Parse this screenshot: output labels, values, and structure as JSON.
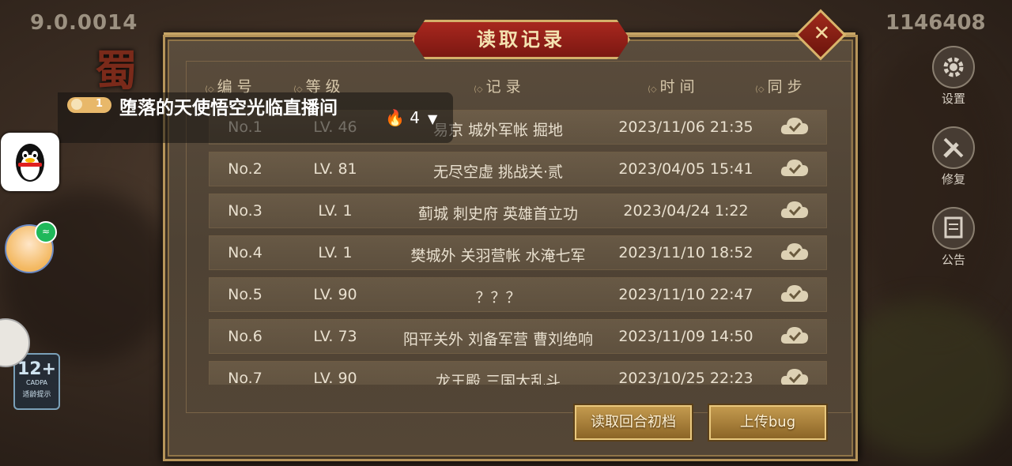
{
  "hud": {
    "version": "9.0.0014",
    "score": "1146408",
    "logo_char": "蜀"
  },
  "side_menu": [
    {
      "label": "设置",
      "icon": "gear-icon"
    },
    {
      "label": "修复",
      "icon": "wrench-icon"
    },
    {
      "label": "公告",
      "icon": "notice-icon"
    }
  ],
  "age_rating": {
    "value": "12+",
    "org": "CADPA",
    "tip": "适龄提示"
  },
  "dialog": {
    "title": "读取记录",
    "columns": {
      "no": "编号",
      "level": "等级",
      "record": "记录",
      "time": "时间",
      "sync": "同步"
    },
    "rows": [
      {
        "no": "No.1",
        "level": "LV. 46",
        "record": "易京  城外军帐 掘地",
        "time": "2023/11/06 21:35"
      },
      {
        "no": "No.2",
        "level": "LV. 81",
        "record": "无尽空虚 挑战关·贰",
        "time": "2023/04/05 15:41"
      },
      {
        "no": "No.3",
        "level": "LV. 1",
        "record": "蓟城  刺史府 英雄首立功",
        "time": "2023/04/24 1:22"
      },
      {
        "no": "No.4",
        "level": "LV. 1",
        "record": "樊城外  关羽营帐 水淹七军",
        "time": "2023/11/10 18:52"
      },
      {
        "no": "No.5",
        "level": "LV. 90",
        "record": "？？？",
        "time": "2023/11/10 22:47"
      },
      {
        "no": "No.6",
        "level": "LV. 73",
        "record": "阳平关外  刘备军营 曹刘绝响",
        "time": "2023/11/09 14:50"
      },
      {
        "no": "No.7",
        "level": "LV. 90",
        "record": "龙王殿 三国大乱斗",
        "time": "2023/10/25 22:23"
      }
    ],
    "buttons": {
      "read_round": "读取回合初档",
      "upload_bug": "上传bug"
    }
  },
  "live": {
    "rank": "1",
    "streamer": "堕落的天使悟空光临直播间",
    "fire_count": "4"
  }
}
